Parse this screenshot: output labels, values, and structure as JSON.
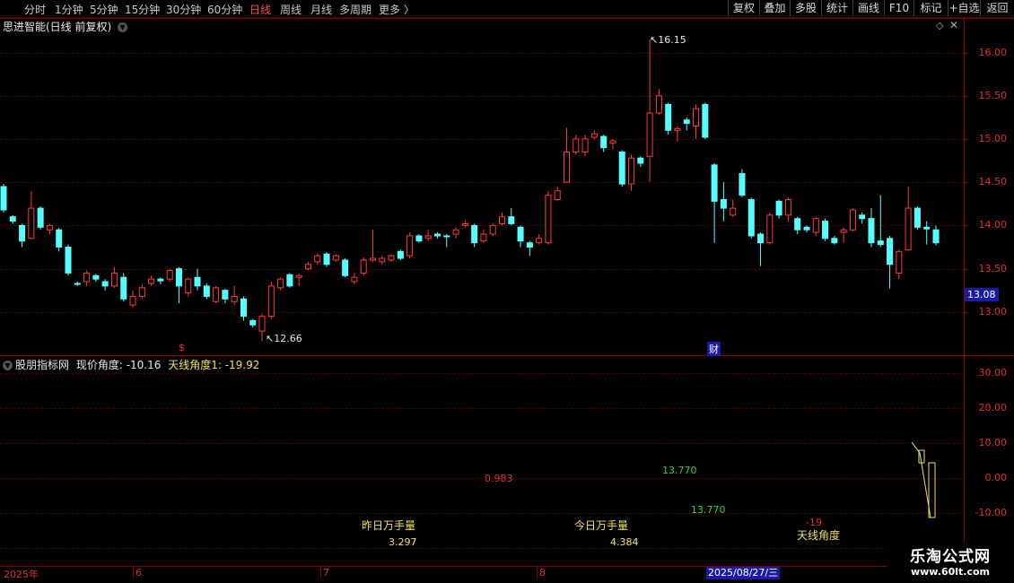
{
  "toolbar": {
    "periods": [
      {
        "label": "分时",
        "active": false
      },
      {
        "label": "1分钟",
        "active": false
      },
      {
        "label": "5分钟",
        "active": false
      },
      {
        "label": "15分钟",
        "active": false
      },
      {
        "label": "30分钟",
        "active": false
      },
      {
        "label": "60分钟",
        "active": false
      },
      {
        "label": "日线",
        "active": true
      },
      {
        "label": "周线",
        "active": false
      },
      {
        "label": "月线",
        "active": false
      },
      {
        "label": "多周期",
        "active": false
      },
      {
        "label": "更多 〉",
        "active": false
      }
    ],
    "right_buttons": [
      "复权",
      "叠加",
      "多股",
      "统计",
      "画线",
      "F10",
      "标记",
      "+自选",
      "返回"
    ]
  },
  "main_chart": {
    "title": "思进智能(日线 前复权)",
    "high_marker": "16.15",
    "low_marker": "12.66",
    "current_price": "13.08",
    "event_marker_1": "$",
    "event_marker_2": "财",
    "y_ticks": [
      "16.00",
      "15.50",
      "15.00",
      "14.50",
      "14.00",
      "13.50",
      "13.00"
    ]
  },
  "indicator": {
    "name": "股朋指标网",
    "label1": "现价角度: -10.16",
    "label2": "天线角度1: -19.92",
    "y_ticks": [
      "30.00",
      "20.00",
      "10.00",
      "0.00",
      "-10.00",
      "-20.00"
    ],
    "texts": [
      {
        "text": "0.983",
        "color": "#e03030"
      },
      {
        "text": "13.770",
        "color": "#3ad03a"
      },
      {
        "text": "13.770",
        "color": "#3ad03a"
      },
      {
        "text": "昨日万手量",
        "color": "#f0e060"
      },
      {
        "text": "3.297",
        "color": "#f0e060"
      },
      {
        "text": "今日万手量",
        "color": "#f0e060"
      },
      {
        "text": "4.384",
        "color": "#f0e060"
      },
      {
        "text": "-19",
        "color": "#e03030"
      },
      {
        "text": "天线角度",
        "color": "#f0e060"
      }
    ]
  },
  "axis": {
    "labels": [
      "2025年",
      "6",
      "7",
      "8"
    ],
    "selected_date": "2025/08/27/三"
  },
  "watermark": {
    "line1": "乐淘公式网",
    "line2": "www.60lt.com"
  },
  "colors": {
    "up": "#ff3a3a",
    "down": "#54ffff",
    "grid": "#8a0000",
    "axis_text": "#e03030"
  },
  "chart_data": {
    "type": "candlestick",
    "y_range": [
      12.5,
      16.4
    ],
    "candles": [
      {
        "o": 14.45,
        "c": 14.18,
        "h": 14.48,
        "l": 14.15
      },
      {
        "o": 14.1,
        "c": 14.05,
        "h": 14.12,
        "l": 14.02
      },
      {
        "o": 14.0,
        "c": 13.82,
        "h": 14.02,
        "l": 13.75
      },
      {
        "o": 13.85,
        "c": 14.2,
        "h": 14.4,
        "l": 13.85
      },
      {
        "o": 14.2,
        "c": 13.98,
        "h": 14.22,
        "l": 13.95
      },
      {
        "o": 13.95,
        "c": 14.0,
        "h": 14.02,
        "l": 13.9
      },
      {
        "o": 13.95,
        "c": 13.75,
        "h": 13.97,
        "l": 13.7
      },
      {
        "o": 13.75,
        "c": 13.45,
        "h": 13.78,
        "l": 13.42
      },
      {
        "o": 13.33,
        "c": 13.32,
        "h": 13.35,
        "l": 13.3
      },
      {
        "o": 13.35,
        "c": 13.45,
        "h": 13.48,
        "l": 13.3
      },
      {
        "o": 13.42,
        "c": 13.38,
        "h": 13.44,
        "l": 13.35
      },
      {
        "o": 13.35,
        "c": 13.3,
        "h": 13.38,
        "l": 13.25
      },
      {
        "o": 13.3,
        "c": 13.45,
        "h": 13.52,
        "l": 13.28
      },
      {
        "o": 13.4,
        "c": 13.15,
        "h": 13.45,
        "l": 13.12
      },
      {
        "o": 13.08,
        "c": 13.18,
        "h": 13.25,
        "l": 13.05
      },
      {
        "o": 13.18,
        "c": 13.28,
        "h": 13.32,
        "l": 13.15
      },
      {
        "o": 13.33,
        "c": 13.38,
        "h": 13.42,
        "l": 13.3
      },
      {
        "o": 13.38,
        "c": 13.36,
        "h": 13.4,
        "l": 13.32
      },
      {
        "o": 13.38,
        "c": 13.48,
        "h": 13.5,
        "l": 13.35
      },
      {
        "o": 13.5,
        "c": 13.3,
        "h": 13.52,
        "l": 13.1
      },
      {
        "o": 13.22,
        "c": 13.38,
        "h": 13.4,
        "l": 13.18
      },
      {
        "o": 13.4,
        "c": 13.3,
        "h": 13.5,
        "l": 13.25
      },
      {
        "o": 13.3,
        "c": 13.18,
        "h": 13.33,
        "l": 13.15
      },
      {
        "o": 13.12,
        "c": 13.28,
        "h": 13.3,
        "l": 13.1
      },
      {
        "o": 13.25,
        "c": 13.15,
        "h": 13.27,
        "l": 13.1
      },
      {
        "o": 13.12,
        "c": 13.18,
        "h": 13.3,
        "l": 13.08
      },
      {
        "o": 13.15,
        "c": 12.95,
        "h": 13.18,
        "l": 12.9
      },
      {
        "o": 12.9,
        "c": 12.85,
        "h": 12.92,
        "l": 12.82
      },
      {
        "o": 12.78,
        "c": 12.95,
        "h": 12.98,
        "l": 12.66
      },
      {
        "o": 12.95,
        "c": 13.3,
        "h": 13.35,
        "l": 12.92
      },
      {
        "o": 13.28,
        "c": 13.38,
        "h": 13.4,
        "l": 13.25
      },
      {
        "o": 13.43,
        "c": 13.3,
        "h": 13.45,
        "l": 13.28
      },
      {
        "o": 13.4,
        "c": 13.42,
        "h": 13.44,
        "l": 13.3
      },
      {
        "o": 13.5,
        "c": 13.55,
        "h": 13.58,
        "l": 13.48
      },
      {
        "o": 13.58,
        "c": 13.65,
        "h": 13.68,
        "l": 13.55
      },
      {
        "o": 13.67,
        "c": 13.55,
        "h": 13.69,
        "l": 13.52
      },
      {
        "o": 13.6,
        "c": 13.65,
        "h": 13.67,
        "l": 13.58
      },
      {
        "o": 13.6,
        "c": 13.42,
        "h": 13.62,
        "l": 13.4
      },
      {
        "o": 13.35,
        "c": 13.4,
        "h": 13.45,
        "l": 13.32
      },
      {
        "o": 13.45,
        "c": 13.6,
        "h": 13.63,
        "l": 13.42
      },
      {
        "o": 13.6,
        "c": 13.62,
        "h": 13.95,
        "l": 13.58
      },
      {
        "o": 13.58,
        "c": 13.62,
        "h": 13.65,
        "l": 13.55
      },
      {
        "o": 13.6,
        "c": 13.65,
        "h": 13.67,
        "l": 13.58
      },
      {
        "o": 13.7,
        "c": 13.62,
        "h": 13.72,
        "l": 13.6
      },
      {
        "o": 13.65,
        "c": 13.88,
        "h": 13.92,
        "l": 13.62
      },
      {
        "o": 13.88,
        "c": 13.82,
        "h": 13.9,
        "l": 13.8
      },
      {
        "o": 13.85,
        "c": 13.88,
        "h": 13.95,
        "l": 13.82
      },
      {
        "o": 13.9,
        "c": 13.88,
        "h": 13.92,
        "l": 13.85
      },
      {
        "o": 13.88,
        "c": 13.87,
        "h": 13.9,
        "l": 13.75
      },
      {
        "o": 13.9,
        "c": 13.95,
        "h": 13.98,
        "l": 13.85
      },
      {
        "o": 14.0,
        "c": 14.02,
        "h": 14.06,
        "l": 13.98
      },
      {
        "o": 14.0,
        "c": 13.8,
        "h": 14.02,
        "l": 13.75
      },
      {
        "o": 13.82,
        "c": 13.9,
        "h": 13.95,
        "l": 13.8
      },
      {
        "o": 13.9,
        "c": 14.0,
        "h": 14.02,
        "l": 13.88
      },
      {
        "o": 14.02,
        "c": 14.1,
        "h": 14.15,
        "l": 14.0
      },
      {
        "o": 14.1,
        "c": 14.02,
        "h": 14.2,
        "l": 14.0
      },
      {
        "o": 13.98,
        "c": 13.82,
        "h": 14.0,
        "l": 13.75
      },
      {
        "o": 13.8,
        "c": 13.75,
        "h": 13.82,
        "l": 13.65
      },
      {
        "o": 13.8,
        "c": 13.85,
        "h": 13.9,
        "l": 13.78
      },
      {
        "o": 13.8,
        "c": 14.35,
        "h": 14.4,
        "l": 13.78
      },
      {
        "o": 14.3,
        "c": 14.4,
        "h": 14.45,
        "l": 14.28
      },
      {
        "o": 14.5,
        "c": 14.85,
        "h": 15.13,
        "l": 14.5
      },
      {
        "o": 14.85,
        "c": 15.0,
        "h": 15.05,
        "l": 14.82
      },
      {
        "o": 14.85,
        "c": 15.0,
        "h": 15.05,
        "l": 14.8
      },
      {
        "o": 15.02,
        "c": 15.06,
        "h": 15.1,
        "l": 15.0
      },
      {
        "o": 15.03,
        "c": 14.9,
        "h": 15.05,
        "l": 14.85
      },
      {
        "o": 14.95,
        "c": 14.98,
        "h": 15.0,
        "l": 14.88
      },
      {
        "o": 14.85,
        "c": 14.48,
        "h": 14.87,
        "l": 14.45
      },
      {
        "o": 14.48,
        "c": 14.78,
        "h": 14.82,
        "l": 14.4
      },
      {
        "o": 14.78,
        "c": 14.72,
        "h": 14.8,
        "l": 14.68
      },
      {
        "o": 14.8,
        "c": 15.3,
        "h": 16.15,
        "l": 14.5
      },
      {
        "o": 15.3,
        "c": 15.5,
        "h": 15.58,
        "l": 15.28
      },
      {
        "o": 15.4,
        "c": 15.1,
        "h": 15.42,
        "l": 15.05
      },
      {
        "o": 15.1,
        "c": 15.12,
        "h": 15.15,
        "l": 14.97
      },
      {
        "o": 15.22,
        "c": 15.18,
        "h": 15.25,
        "l": 15.1
      },
      {
        "o": 15.15,
        "c": 15.35,
        "h": 15.4,
        "l": 15.0
      },
      {
        "o": 15.4,
        "c": 15.02,
        "h": 15.42,
        "l": 15.0
      },
      {
        "o": 14.7,
        "c": 14.28,
        "h": 14.72,
        "l": 13.8
      },
      {
        "o": 14.3,
        "c": 14.2,
        "h": 14.5,
        "l": 14.05
      },
      {
        "o": 14.12,
        "c": 14.2,
        "h": 14.3,
        "l": 14.1
      },
      {
        "o": 14.6,
        "c": 14.35,
        "h": 14.65,
        "l": 14.33
      },
      {
        "o": 14.3,
        "c": 13.88,
        "h": 14.32,
        "l": 13.85
      },
      {
        "o": 13.9,
        "c": 13.8,
        "h": 13.92,
        "l": 13.53
      },
      {
        "o": 13.8,
        "c": 14.12,
        "h": 14.15,
        "l": 13.78
      },
      {
        "o": 14.28,
        "c": 14.12,
        "h": 14.3,
        "l": 14.08
      },
      {
        "o": 14.12,
        "c": 14.3,
        "h": 14.32,
        "l": 14.05
      },
      {
        "o": 14.08,
        "c": 13.95,
        "h": 14.1,
        "l": 13.9
      },
      {
        "o": 13.98,
        "c": 13.95,
        "h": 14.0,
        "l": 13.92
      },
      {
        "o": 13.92,
        "c": 14.08,
        "h": 14.1,
        "l": 13.88
      },
      {
        "o": 14.05,
        "c": 13.85,
        "h": 14.08,
        "l": 13.82
      },
      {
        "o": 13.85,
        "c": 13.8,
        "h": 13.88,
        "l": 13.78
      },
      {
        "o": 13.92,
        "c": 13.95,
        "h": 13.98,
        "l": 13.8
      },
      {
        "o": 13.95,
        "c": 14.18,
        "h": 14.2,
        "l": 13.93
      },
      {
        "o": 14.12,
        "c": 14.08,
        "h": 14.15,
        "l": 14.02
      },
      {
        "o": 14.08,
        "c": 13.8,
        "h": 14.2,
        "l": 13.75
      },
      {
        "o": 13.82,
        "c": 13.78,
        "h": 14.35,
        "l": 13.75
      },
      {
        "o": 13.85,
        "c": 13.55,
        "h": 13.88,
        "l": 13.27
      },
      {
        "o": 13.45,
        "c": 13.7,
        "h": 13.72,
        "l": 13.38
      },
      {
        "o": 13.72,
        "c": 14.2,
        "h": 14.45,
        "l": 13.7
      },
      {
        "o": 14.2,
        "c": 13.98,
        "h": 14.22,
        "l": 13.95
      },
      {
        "o": 13.98,
        "c": 13.96,
        "h": 14.05,
        "l": 13.78
      },
      {
        "o": 13.95,
        "c": 13.8,
        "h": 14.0,
        "l": 13.77
      }
    ]
  }
}
